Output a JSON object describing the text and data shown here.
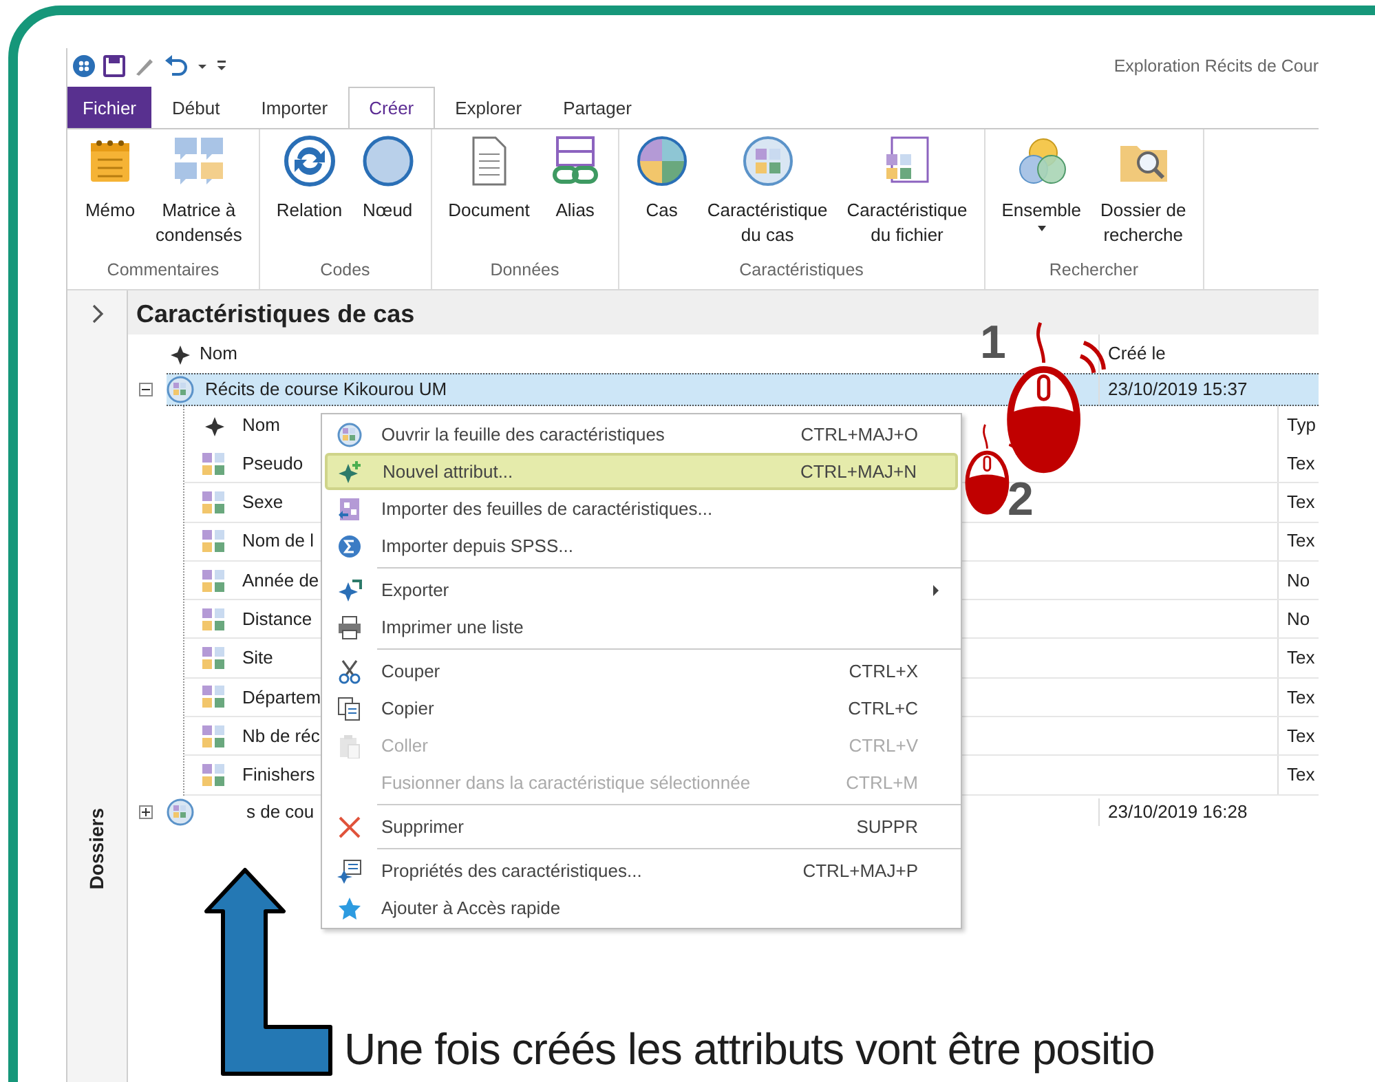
{
  "window": {
    "title": "Exploration Récits de Cour"
  },
  "ribbon_tabs": [
    {
      "label": "Fichier",
      "kind": "file",
      "selected": false
    },
    {
      "label": "Début",
      "kind": "tab",
      "selected": false
    },
    {
      "label": "Importer",
      "kind": "tab",
      "selected": false
    },
    {
      "label": "Créer",
      "kind": "tab",
      "selected": true
    },
    {
      "label": "Explorer",
      "kind": "tab",
      "selected": false
    },
    {
      "label": "Partager",
      "kind": "tab",
      "selected": false
    }
  ],
  "ribbon_groups": [
    {
      "label": "Commentaires",
      "buttons": [
        {
          "lines": [
            "Mémo"
          ],
          "dropdown": false
        },
        {
          "lines": [
            "Matrice à",
            "condensés"
          ],
          "dropdown": false
        }
      ]
    },
    {
      "label": "Codes",
      "buttons": [
        {
          "lines": [
            "Relation"
          ],
          "dropdown": false
        },
        {
          "lines": [
            "Nœud"
          ],
          "dropdown": false
        }
      ]
    },
    {
      "label": "Données",
      "buttons": [
        {
          "lines": [
            "Document"
          ],
          "dropdown": false
        },
        {
          "lines": [
            "Alias"
          ],
          "dropdown": false
        }
      ]
    },
    {
      "label": "Caractéristiques",
      "buttons": [
        {
          "lines": [
            "Cas"
          ],
          "dropdown": false
        },
        {
          "lines": [
            "Caractéristique",
            "du cas"
          ],
          "dropdown": false
        },
        {
          "lines": [
            "Caractéristique",
            "du fichier"
          ],
          "dropdown": false
        }
      ]
    },
    {
      "label": "Rechercher",
      "buttons": [
        {
          "lines": [
            "Ensemble"
          ],
          "dropdown": true
        },
        {
          "lines": [
            "Dossier de",
            "recherche"
          ],
          "dropdown": false
        }
      ]
    }
  ],
  "side_panel": {
    "label": "Dossiers"
  },
  "view": {
    "title": "Caractéristiques de cas",
    "columns": [
      "Nom",
      "Créé le"
    ],
    "rows": [
      {
        "name": "Récits de course Kikourou UM",
        "created": "23/10/2019 15:37",
        "expanded": true,
        "selected": true,
        "children": {
          "columns": [
            "Nom",
            "Typ"
          ],
          "rows": [
            {
              "name": "Pseudo",
              "type": "Tex"
            },
            {
              "name": "Sexe",
              "type": "Tex"
            },
            {
              "name": "Nom de l",
              "type": "Tex"
            },
            {
              "name": "Année de",
              "type": "No"
            },
            {
              "name": "Distance",
              "type": "No"
            },
            {
              "name": "Site",
              "type": "Tex"
            },
            {
              "name": "Départem",
              "type": "Tex"
            },
            {
              "name": "Nb de réc",
              "type": "Tex"
            },
            {
              "name": "Finishers",
              "type": "Tex"
            }
          ]
        }
      },
      {
        "name": "s de cou",
        "created": "23/10/2019 16:28",
        "expanded": false,
        "selected": false
      }
    ]
  },
  "context_menu": {
    "sections": [
      [
        {
          "label": "Ouvrir la feuille des caractéristiques",
          "shortcut": "CTRL+MAJ+O",
          "disabled": false,
          "selected": false,
          "submenu": false
        },
        {
          "label": "Nouvel attribut...",
          "shortcut": "CTRL+MAJ+N",
          "disabled": false,
          "selected": true,
          "submenu": false
        },
        {
          "label": "Importer des feuilles de caractéristiques...",
          "disabled": false,
          "selected": false,
          "submenu": false
        },
        {
          "label": "Importer depuis SPSS...",
          "disabled": false,
          "selected": false,
          "submenu": false
        }
      ],
      [
        {
          "label": "Exporter",
          "disabled": false,
          "selected": false,
          "submenu": true
        },
        {
          "label": "Imprimer une liste",
          "disabled": false,
          "selected": false,
          "submenu": false
        }
      ],
      [
        {
          "label": "Couper",
          "shortcut": "CTRL+X",
          "disabled": false,
          "selected": false,
          "submenu": false
        },
        {
          "label": "Copier",
          "shortcut": "CTRL+C",
          "disabled": false,
          "selected": false,
          "submenu": false
        },
        {
          "label": "Coller",
          "shortcut": "CTRL+V",
          "disabled": true,
          "selected": false,
          "submenu": false
        },
        {
          "label": "Fusionner dans la caractéristique sélectionnée",
          "shortcut": "CTRL+M",
          "disabled": true,
          "selected": false,
          "submenu": false
        }
      ],
      [
        {
          "label": "Supprimer",
          "shortcut": "SUPPR",
          "disabled": false,
          "selected": false,
          "submenu": false
        }
      ],
      [
        {
          "label": "Propriétés des caractéristiques...",
          "shortcut": "CTRL+MAJ+P",
          "disabled": false,
          "selected": false,
          "submenu": false
        },
        {
          "label": "Ajouter à Accès rapide",
          "disabled": false,
          "selected": false,
          "submenu": false
        }
      ]
    ]
  },
  "annotations": {
    "steps": [
      "1",
      "2"
    ],
    "caption": "Une fois créés les attributs vont être positio"
  }
}
